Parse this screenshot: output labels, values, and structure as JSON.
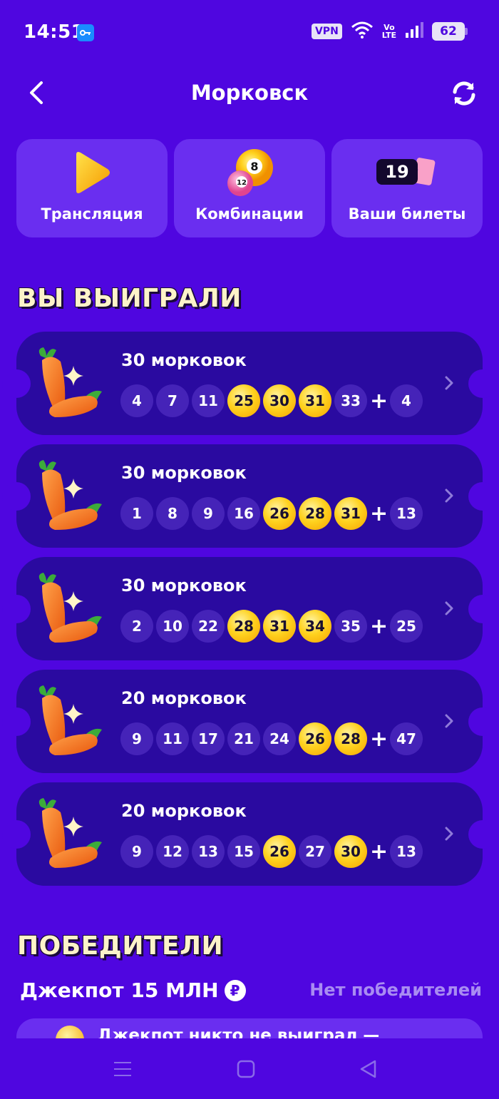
{
  "status_bar": {
    "time": "14:51",
    "vpn": "VPN",
    "volte_top": "Vo",
    "volte_bottom": "LTE",
    "battery": "62"
  },
  "header": {
    "title": "Морковск"
  },
  "top_cards": [
    {
      "label": "Трансляция",
      "icon": "play-icon"
    },
    {
      "label": "Комбинации",
      "icon": "lottery-balls-icon",
      "ball_big": "8",
      "ball_small": "12"
    },
    {
      "label": "Ваши билеты",
      "icon": "ticket-icon",
      "count": "19"
    }
  ],
  "won_section": {
    "title": "ВЫ ВЫИГРАЛИ",
    "rows": [
      {
        "prize": "30 морковок",
        "numbers": [
          "4",
          "7",
          "11",
          "25",
          "30",
          "31",
          "33"
        ],
        "hits": [
          false,
          false,
          false,
          true,
          true,
          true,
          false
        ],
        "bonus": "4"
      },
      {
        "prize": "30 морковок",
        "numbers": [
          "1",
          "8",
          "9",
          "16",
          "26",
          "28",
          "31"
        ],
        "hits": [
          false,
          false,
          false,
          false,
          true,
          true,
          true
        ],
        "bonus": "13"
      },
      {
        "prize": "30 морковок",
        "numbers": [
          "2",
          "10",
          "22",
          "28",
          "31",
          "34",
          "35"
        ],
        "hits": [
          false,
          false,
          false,
          true,
          true,
          true,
          false
        ],
        "bonus": "25"
      },
      {
        "prize": "20 морковок",
        "numbers": [
          "9",
          "11",
          "17",
          "21",
          "24",
          "26",
          "28"
        ],
        "hits": [
          false,
          false,
          false,
          false,
          false,
          true,
          true
        ],
        "bonus": "47"
      },
      {
        "prize": "20 морковок",
        "numbers": [
          "9",
          "12",
          "13",
          "15",
          "26",
          "27",
          "30"
        ],
        "hits": [
          false,
          false,
          false,
          false,
          true,
          false,
          true
        ],
        "bonus": "13"
      }
    ]
  },
  "winners_section": {
    "title": "ПОБЕДИТЕЛИ",
    "jackpot_label": "Джекпот 15 МЛН",
    "currency_symbol": "₽",
    "no_winners": "Нет победителей",
    "notice": "Джекпот никто не выиграл —"
  },
  "colors": {
    "background": "#4f06e0",
    "card": "#6a2ef0",
    "row": "#2a0aa0",
    "ball": "#4523b8",
    "hit": "#ffd21f"
  }
}
